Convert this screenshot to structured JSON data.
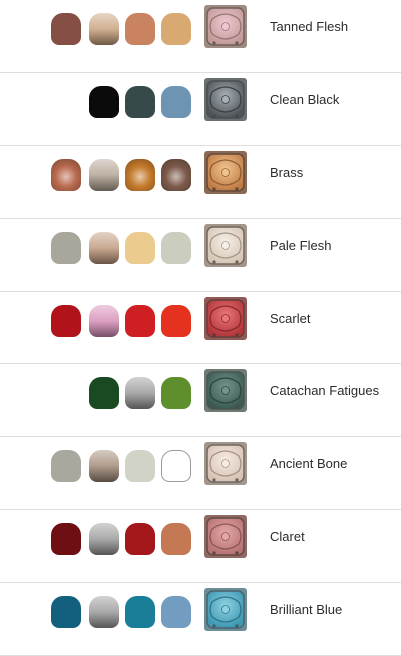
{
  "rows": [
    {
      "name": "Tanned Flesh",
      "swatches": [
        {
          "color": "#864f46",
          "style": "flat"
        },
        {
          "color": "#c9a27f",
          "style": "cream"
        },
        {
          "color": "#c98361",
          "style": "flat"
        },
        {
          "color": "#d8a970",
          "style": "flat"
        }
      ],
      "mini": {
        "base": "#c39a98",
        "light": "#efc7d1",
        "rim": "#9d8b81"
      }
    },
    {
      "name": "Clean Black",
      "swatches": [
        null,
        {
          "color": "#0b0b0b",
          "style": "flat"
        },
        {
          "color": "#364a4a",
          "style": "flat"
        },
        {
          "color": "#6e94b4",
          "style": "flat"
        }
      ],
      "mini": {
        "base": "#4e5458",
        "light": "#a9b0b6",
        "rim": "#6a6f72"
      }
    },
    {
      "name": "Brass",
      "swatches": [
        {
          "color": "#b86a4f",
          "style": "dome"
        },
        {
          "color": "#b3a394",
          "style": "cream"
        },
        {
          "color": "#c47a2c",
          "style": "dome"
        },
        {
          "color": "#7c5a4a",
          "style": "dome"
        }
      ],
      "mini": {
        "base": "#c07b45",
        "light": "#f1c48e",
        "rim": "#8b6a55"
      }
    },
    {
      "name": "Pale Flesh",
      "swatches": [
        {
          "color": "#a9a69c",
          "style": "flat"
        },
        {
          "color": "#c09a7d",
          "style": "cream"
        },
        {
          "color": "#eccb8e",
          "style": "flat"
        },
        {
          "color": "#cbcdbf",
          "style": "flat"
        }
      ],
      "mini": {
        "base": "#d6c6b6",
        "light": "#f6efe6",
        "rim": "#a3958a"
      }
    },
    {
      "name": "Scarlet",
      "swatches": [
        {
          "color": "#b0131a",
          "style": "flat"
        },
        {
          "color": "#d78fb7",
          "style": "cream"
        },
        {
          "color": "#cf1f23",
          "style": "flat"
        },
        {
          "color": "#e4321e",
          "style": "flat"
        }
      ],
      "mini": {
        "base": "#b2353a",
        "light": "#e97779",
        "rim": "#8f5a55"
      }
    },
    {
      "name": "Catachan Fatigues",
      "swatches": [
        null,
        {
          "color": "#194a22",
          "style": "flat"
        },
        {
          "color": "#9a9a9a",
          "style": "cream"
        },
        {
          "color": "#5f8f2d",
          "style": "flat"
        }
      ],
      "mini": {
        "base": "#3b5a53",
        "light": "#74958d",
        "rim": "#6e7a72"
      }
    },
    {
      "name": "Ancient Bone",
      "swatches": [
        {
          "color": "#a9a89f",
          "style": "flat"
        },
        {
          "color": "#a18b78",
          "style": "cream"
        },
        {
          "color": "#d1d3c6",
          "style": "flat"
        },
        {
          "color": "#ffffff",
          "style": "outline"
        }
      ],
      "mini": {
        "base": "#d8c3b5",
        "light": "#f7ebe2",
        "rim": "#a2958c"
      }
    },
    {
      "name": "Claret",
      "swatches": [
        {
          "color": "#6e0f14",
          "style": "flat"
        },
        {
          "color": "#9b9b9b",
          "style": "cream"
        },
        {
          "color": "#a3171a",
          "style": "flat"
        },
        {
          "color": "#c47954",
          "style": "flat"
        }
      ],
      "mini": {
        "base": "#b77273",
        "light": "#e3a7a7",
        "rim": "#8f6a64"
      }
    },
    {
      "name": "Brilliant Blue",
      "swatches": [
        {
          "color": "#12607e",
          "style": "flat"
        },
        {
          "color": "#9a9a9a",
          "style": "cream"
        },
        {
          "color": "#1a7e99",
          "style": "flat"
        },
        {
          "color": "#729cc0",
          "style": "flat"
        }
      ],
      "mini": {
        "base": "#3e98b2",
        "light": "#8fd2e3",
        "rim": "#6b8d97"
      }
    }
  ]
}
